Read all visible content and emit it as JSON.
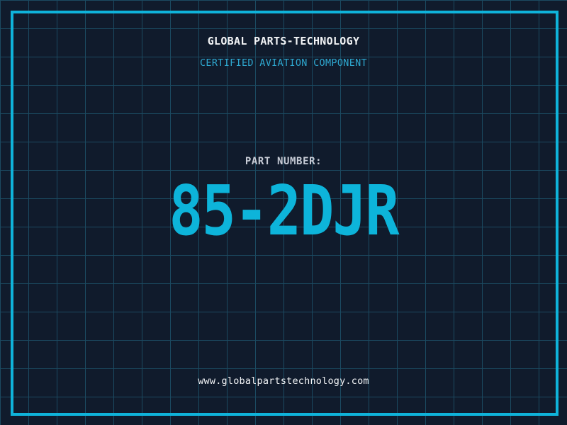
{
  "header": {
    "company": "GLOBAL PARTS-TECHNOLOGY",
    "subtitle": "CERTIFIED AVIATION COMPONENT"
  },
  "part": {
    "label": "PART NUMBER:",
    "value": "85-2DJR"
  },
  "footer": {
    "website": "www.globalpartstechnology.com"
  },
  "colors": {
    "background": "#101b2c",
    "grid_line": "#1b4a61",
    "frame_cyan": "#0fb3da",
    "part_number_cyan": "#0db4da",
    "subtitle_cyan": "#2ea7cf",
    "label_gray": "#c7ccd6",
    "text_white": "#f2f4f6"
  }
}
